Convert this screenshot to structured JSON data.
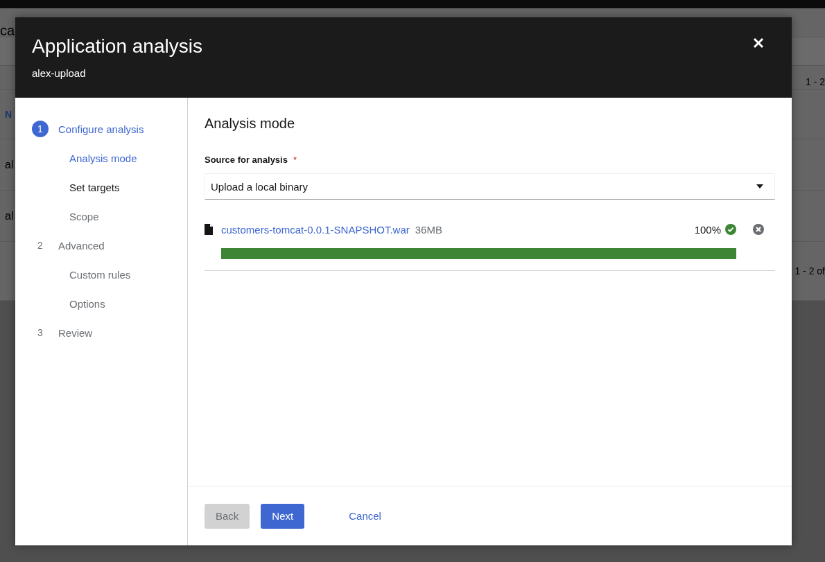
{
  "backdrop": {
    "title": "ca",
    "pagination_top": "1 - 2",
    "column_1": "N",
    "rows": [
      {
        "column_1": "al"
      },
      {
        "column_1": "al"
      }
    ],
    "pagination_bottom": "1 - 2 of"
  },
  "modal": {
    "title": "Application analysis",
    "subtitle": "alex-upload"
  },
  "steps": [
    {
      "number": "1",
      "label": "Configure analysis",
      "selected": true,
      "disabled": false,
      "children": [
        {
          "label": "Analysis mode",
          "selected": true,
          "disabled": false
        },
        {
          "label": "Set targets",
          "selected": false,
          "disabled": false
        },
        {
          "label": "Scope",
          "selected": false,
          "disabled": true
        }
      ]
    },
    {
      "number": "2",
      "label": "Advanced",
      "selected": false,
      "disabled": true,
      "children": [
        {
          "label": "Custom rules",
          "selected": false,
          "disabled": true
        },
        {
          "label": "Options",
          "selected": false,
          "disabled": true
        }
      ]
    },
    {
      "number": "3",
      "label": "Review",
      "selected": false,
      "disabled": true
    }
  ],
  "content": {
    "heading": "Analysis mode",
    "field": {
      "label": "Source for analysis",
      "required_mark": "*",
      "value": "Upload a local binary"
    },
    "upload": {
      "file_name": "customers-tomcat-0.0.1-SNAPSHOT.war",
      "size": "36MB",
      "percent": "100%",
      "level": 1
    }
  },
  "footer": {
    "buttons": [
      {
        "label": "Back",
        "kind": "secondary",
        "disabled": true
      },
      {
        "label": "Next",
        "kind": "primary",
        "disabled": false
      },
      {
        "label": "Cancel",
        "kind": "link",
        "disabled": false
      }
    ]
  }
}
